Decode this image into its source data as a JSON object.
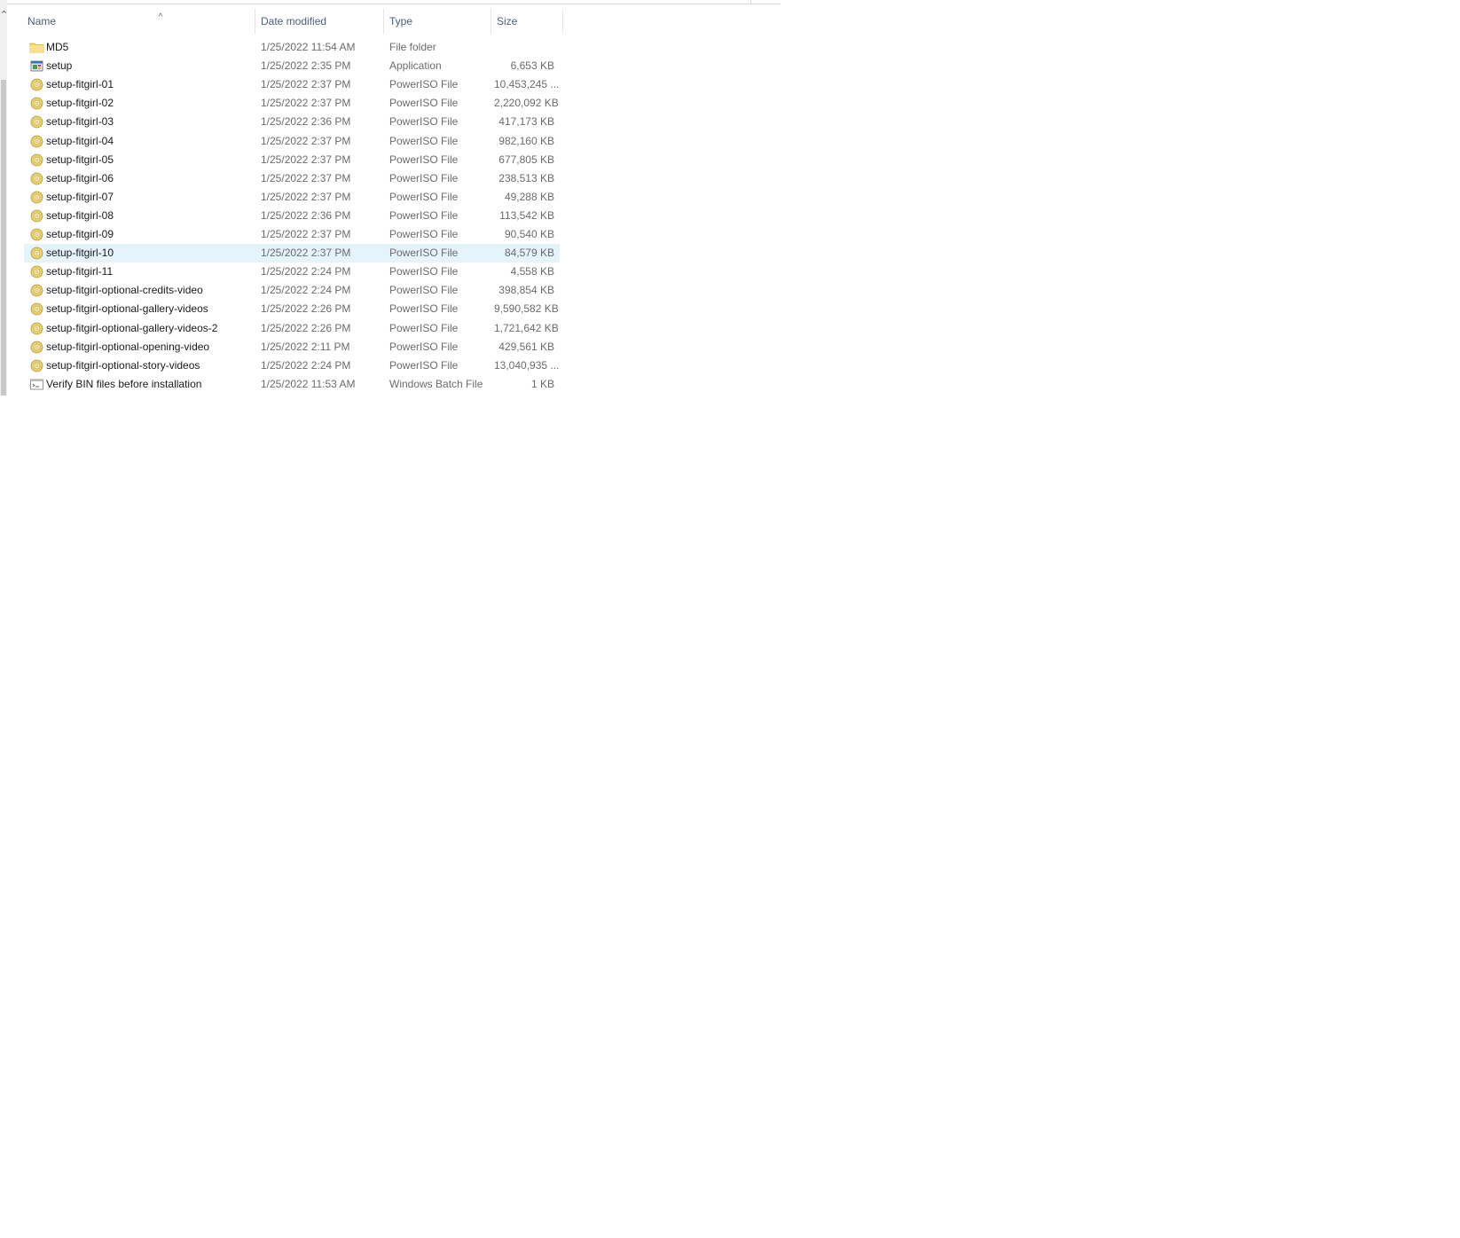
{
  "columns": {
    "name": "Name",
    "date": "Date modified",
    "type": "Type",
    "size": "Size"
  },
  "sort": {
    "column": "name",
    "indicator": "^"
  },
  "colors": {
    "selected_row": "#e5f3fb",
    "header_text": "#4c607a",
    "secondary_text": "#6b6b6b",
    "folder_yellow": "#f7d570",
    "disc_gold": "#d8b94a"
  },
  "files": [
    {
      "name": "MD5",
      "date": "1/25/2022 11:54 AM",
      "type": "File folder",
      "size": "",
      "icon": "folder-icon"
    },
    {
      "name": "setup",
      "date": "1/25/2022 2:35 PM",
      "type": "Application",
      "size": "6,653 KB",
      "icon": "application-icon"
    },
    {
      "name": "setup-fitgirl-01",
      "date": "1/25/2022 2:37 PM",
      "type": "PowerISO File",
      "size": "10,453,245 ...",
      "icon": "poweriso-file-icon"
    },
    {
      "name": "setup-fitgirl-02",
      "date": "1/25/2022 2:37 PM",
      "type": "PowerISO File",
      "size": "2,220,092 KB",
      "icon": "poweriso-file-icon"
    },
    {
      "name": "setup-fitgirl-03",
      "date": "1/25/2022 2:36 PM",
      "type": "PowerISO File",
      "size": "417,173 KB",
      "icon": "poweriso-file-icon"
    },
    {
      "name": "setup-fitgirl-04",
      "date": "1/25/2022 2:37 PM",
      "type": "PowerISO File",
      "size": "982,160 KB",
      "icon": "poweriso-file-icon"
    },
    {
      "name": "setup-fitgirl-05",
      "date": "1/25/2022 2:37 PM",
      "type": "PowerISO File",
      "size": "677,805 KB",
      "icon": "poweriso-file-icon"
    },
    {
      "name": "setup-fitgirl-06",
      "date": "1/25/2022 2:37 PM",
      "type": "PowerISO File",
      "size": "238,513 KB",
      "icon": "poweriso-file-icon"
    },
    {
      "name": "setup-fitgirl-07",
      "date": "1/25/2022 2:37 PM",
      "type": "PowerISO File",
      "size": "49,288 KB",
      "icon": "poweriso-file-icon"
    },
    {
      "name": "setup-fitgirl-08",
      "date": "1/25/2022 2:36 PM",
      "type": "PowerISO File",
      "size": "113,542 KB",
      "icon": "poweriso-file-icon"
    },
    {
      "name": "setup-fitgirl-09",
      "date": "1/25/2022 2:37 PM",
      "type": "PowerISO File",
      "size": "90,540 KB",
      "icon": "poweriso-file-icon"
    },
    {
      "name": "setup-fitgirl-10",
      "date": "1/25/2022 2:37 PM",
      "type": "PowerISO File",
      "size": "84,579 KB",
      "icon": "poweriso-file-icon",
      "selected": true
    },
    {
      "name": "setup-fitgirl-11",
      "date": "1/25/2022 2:24 PM",
      "type": "PowerISO File",
      "size": "4,558 KB",
      "icon": "poweriso-file-icon"
    },
    {
      "name": "setup-fitgirl-optional-credits-video",
      "date": "1/25/2022 2:24 PM",
      "type": "PowerISO File",
      "size": "398,854 KB",
      "icon": "poweriso-file-icon"
    },
    {
      "name": "setup-fitgirl-optional-gallery-videos",
      "date": "1/25/2022 2:26 PM",
      "type": "PowerISO File",
      "size": "9,590,582 KB",
      "icon": "poweriso-file-icon"
    },
    {
      "name": "setup-fitgirl-optional-gallery-videos-2",
      "date": "1/25/2022 2:26 PM",
      "type": "PowerISO File",
      "size": "1,721,642 KB",
      "icon": "poweriso-file-icon"
    },
    {
      "name": "setup-fitgirl-optional-opening-video",
      "date": "1/25/2022 2:11 PM",
      "type": "PowerISO File",
      "size": "429,561 KB",
      "icon": "poweriso-file-icon"
    },
    {
      "name": "setup-fitgirl-optional-story-videos",
      "date": "1/25/2022 2:24 PM",
      "type": "PowerISO File",
      "size": "13,040,935 ...",
      "icon": "poweriso-file-icon"
    },
    {
      "name": "Verify BIN files before installation",
      "date": "1/25/2022 11:53 AM",
      "type": "Windows Batch File",
      "size": "1 KB",
      "icon": "batch-file-icon"
    }
  ]
}
